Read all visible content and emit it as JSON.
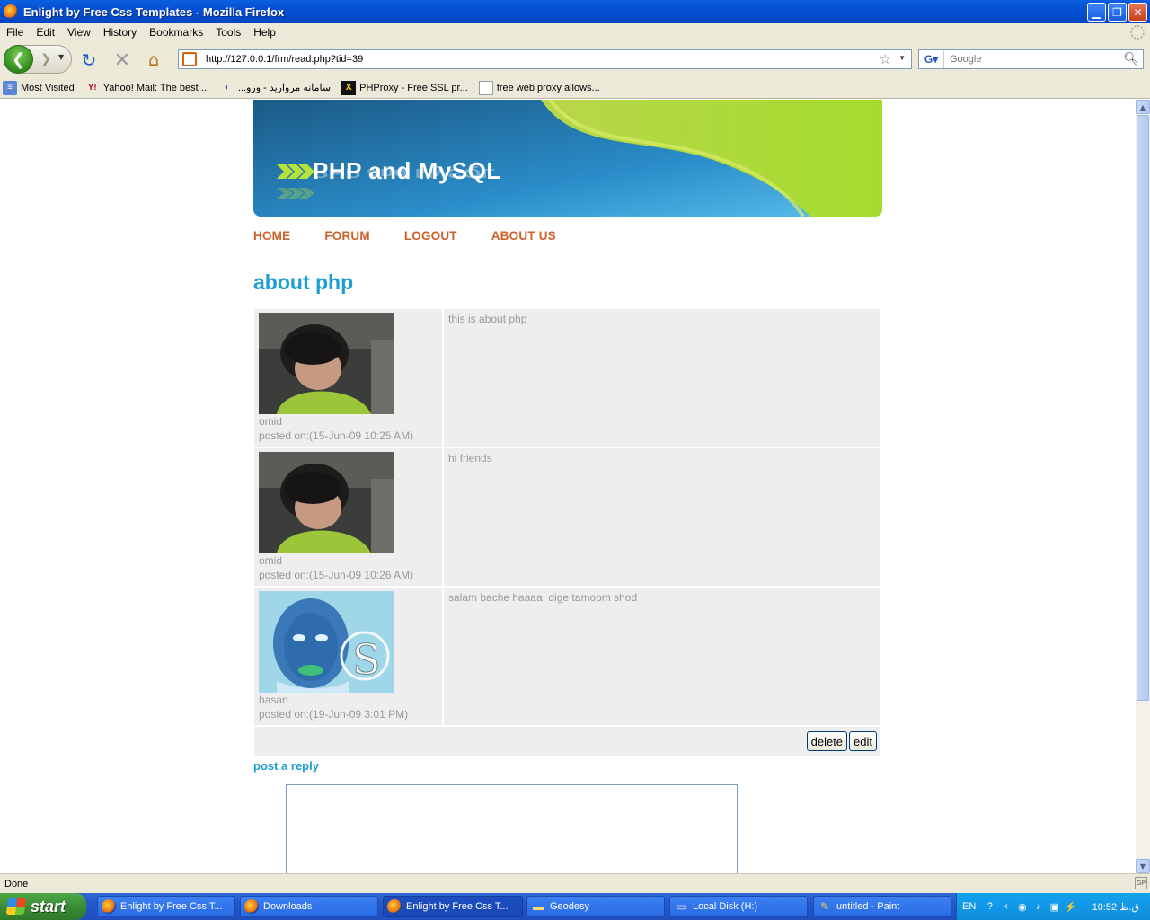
{
  "window": {
    "title": "Enlight by Free Css Templates - Mozilla Firefox",
    "controls": [
      "minimize",
      "restore",
      "close"
    ]
  },
  "menu": [
    "File",
    "Edit",
    "View",
    "History",
    "Bookmarks",
    "Tools",
    "Help"
  ],
  "toolbar": {
    "url": "http://127.0.0.1/frm/read.php?tid=39",
    "search_placeholder": "Google"
  },
  "bookmarks": [
    {
      "label": "Most Visited",
      "icon": "most-visited-icon"
    },
    {
      "label": "Yahoo! Mail: The best ...",
      "icon": "yahoo-icon"
    },
    {
      "label": "سامانه مروارید - ورو...",
      "icon": "morvarid-icon"
    },
    {
      "label": "PHProxy - Free SSL pr...",
      "icon": "phproxy-icon"
    },
    {
      "label": "free web proxy allows...",
      "icon": "page-icon"
    }
  ],
  "page": {
    "banner_title": "PHP and MySQL",
    "nav": [
      "HOME",
      "FORUM",
      "LOGOUT",
      "ABOUT US"
    ],
    "topic_title": "about php",
    "posts": [
      {
        "author": "omid",
        "posted_on": "posted on:(15-Jun-09 10:25 AM)",
        "body": "this is about php"
      },
      {
        "author": "omid",
        "posted_on": "posted on:(15-Jun-09 10:26 AM)",
        "body": "hi friends"
      },
      {
        "author": "hasan",
        "posted_on": "posted on:(19-Jun-09 3:01 PM)",
        "body": "salam bache haaaa. dige tamoom shod"
      }
    ],
    "delete_label": "delete",
    "edit_label": "edit",
    "reply_link": "post a reply",
    "reply_value": ""
  },
  "status": {
    "text": "Done",
    "badge": "GP"
  },
  "taskbar": {
    "start_label": "start",
    "tasks": [
      {
        "label": "Enlight by Free Css T...",
        "icon": "firefox-icon",
        "active": false
      },
      {
        "label": "Downloads",
        "icon": "firefox-icon",
        "active": false
      },
      {
        "label": "Enlight by Free Css T...",
        "icon": "firefox-icon",
        "active": true
      },
      {
        "label": "Geodesy",
        "icon": "folder-icon",
        "active": false
      },
      {
        "label": "Local Disk (H:)",
        "icon": "disk-icon",
        "active": false
      },
      {
        "label": "untitled - Paint",
        "icon": "paint-icon",
        "active": false
      }
    ],
    "lang": "EN",
    "clock": "10:52 ق.ظ"
  },
  "colors": {
    "nav_link": "#d0602a",
    "topic_title": "#1d9ed0",
    "post_bg": "#eeeeee",
    "post_text": "#999999",
    "titlebar": "#0550d2",
    "taskbar": "#2457c8"
  }
}
